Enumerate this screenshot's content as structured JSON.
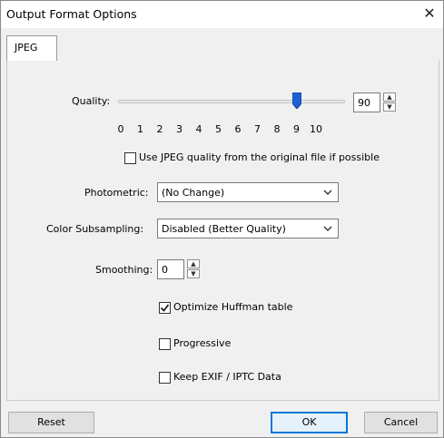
{
  "window": {
    "title": "Output Format Options",
    "close_glyph": "✕"
  },
  "tabs": [
    {
      "label": "JPEG",
      "selected": true
    }
  ],
  "quality": {
    "label": "Quality:",
    "value": "90",
    "slider_position": 0.9,
    "ticks": [
      "0",
      "1",
      "2",
      "3",
      "4",
      "5",
      "6",
      "7",
      "8",
      "9",
      "10"
    ]
  },
  "use_original_quality": {
    "label": "Use JPEG quality from the original file if possible",
    "checked": false
  },
  "photometric": {
    "label": "Photometric:",
    "selected": "(No Change)"
  },
  "subsampling": {
    "label": "Color Subsampling:",
    "selected": "Disabled (Better Quality)"
  },
  "smoothing": {
    "label": "Smoothing:",
    "value": "0"
  },
  "options": [
    {
      "label": "Optimize Huffman table",
      "checked": true
    },
    {
      "label": "Progressive",
      "checked": false
    },
    {
      "label": "Keep EXIF / IPTC Data",
      "checked": false
    }
  ],
  "buttons": {
    "reset": "Reset",
    "ok": "OK",
    "cancel": "Cancel"
  },
  "colors": {
    "accent": "#0078d7",
    "slider_thumb": "#1f5fd6"
  }
}
